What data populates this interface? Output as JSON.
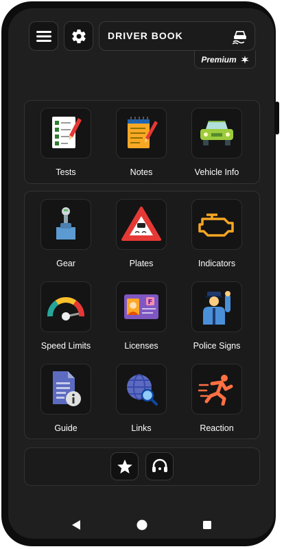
{
  "app": {
    "title": "DRIVER BOOK",
    "premium_label": "Premium"
  },
  "top_tiles": [
    {
      "label": "Tests",
      "icon": "checklist-icon"
    },
    {
      "label": "Notes",
      "icon": "notepad-icon"
    },
    {
      "label": "Vehicle Info",
      "icon": "car-icon"
    }
  ],
  "grid_tiles": [
    {
      "label": "Gear",
      "icon": "gear-stick-icon"
    },
    {
      "label": "Plates",
      "icon": "warning-triangle-icon"
    },
    {
      "label": "Indicators",
      "icon": "engine-light-icon"
    },
    {
      "label": "Speed Limits",
      "icon": "speedometer-icon"
    },
    {
      "label": "Licenses",
      "icon": "license-card-icon"
    },
    {
      "label": "Police Signs",
      "icon": "police-officer-icon"
    },
    {
      "label": "Guide",
      "icon": "document-info-icon"
    },
    {
      "label": "Links",
      "icon": "globe-search-icon"
    },
    {
      "label": "Reaction",
      "icon": "running-man-icon"
    }
  ],
  "bottom": {
    "favorites_icon": "star-icon",
    "support_icon": "headset-icon"
  },
  "colors": {
    "background": "#1f1f1f",
    "tile": "#141414",
    "accent_orange": "#f5a623"
  }
}
